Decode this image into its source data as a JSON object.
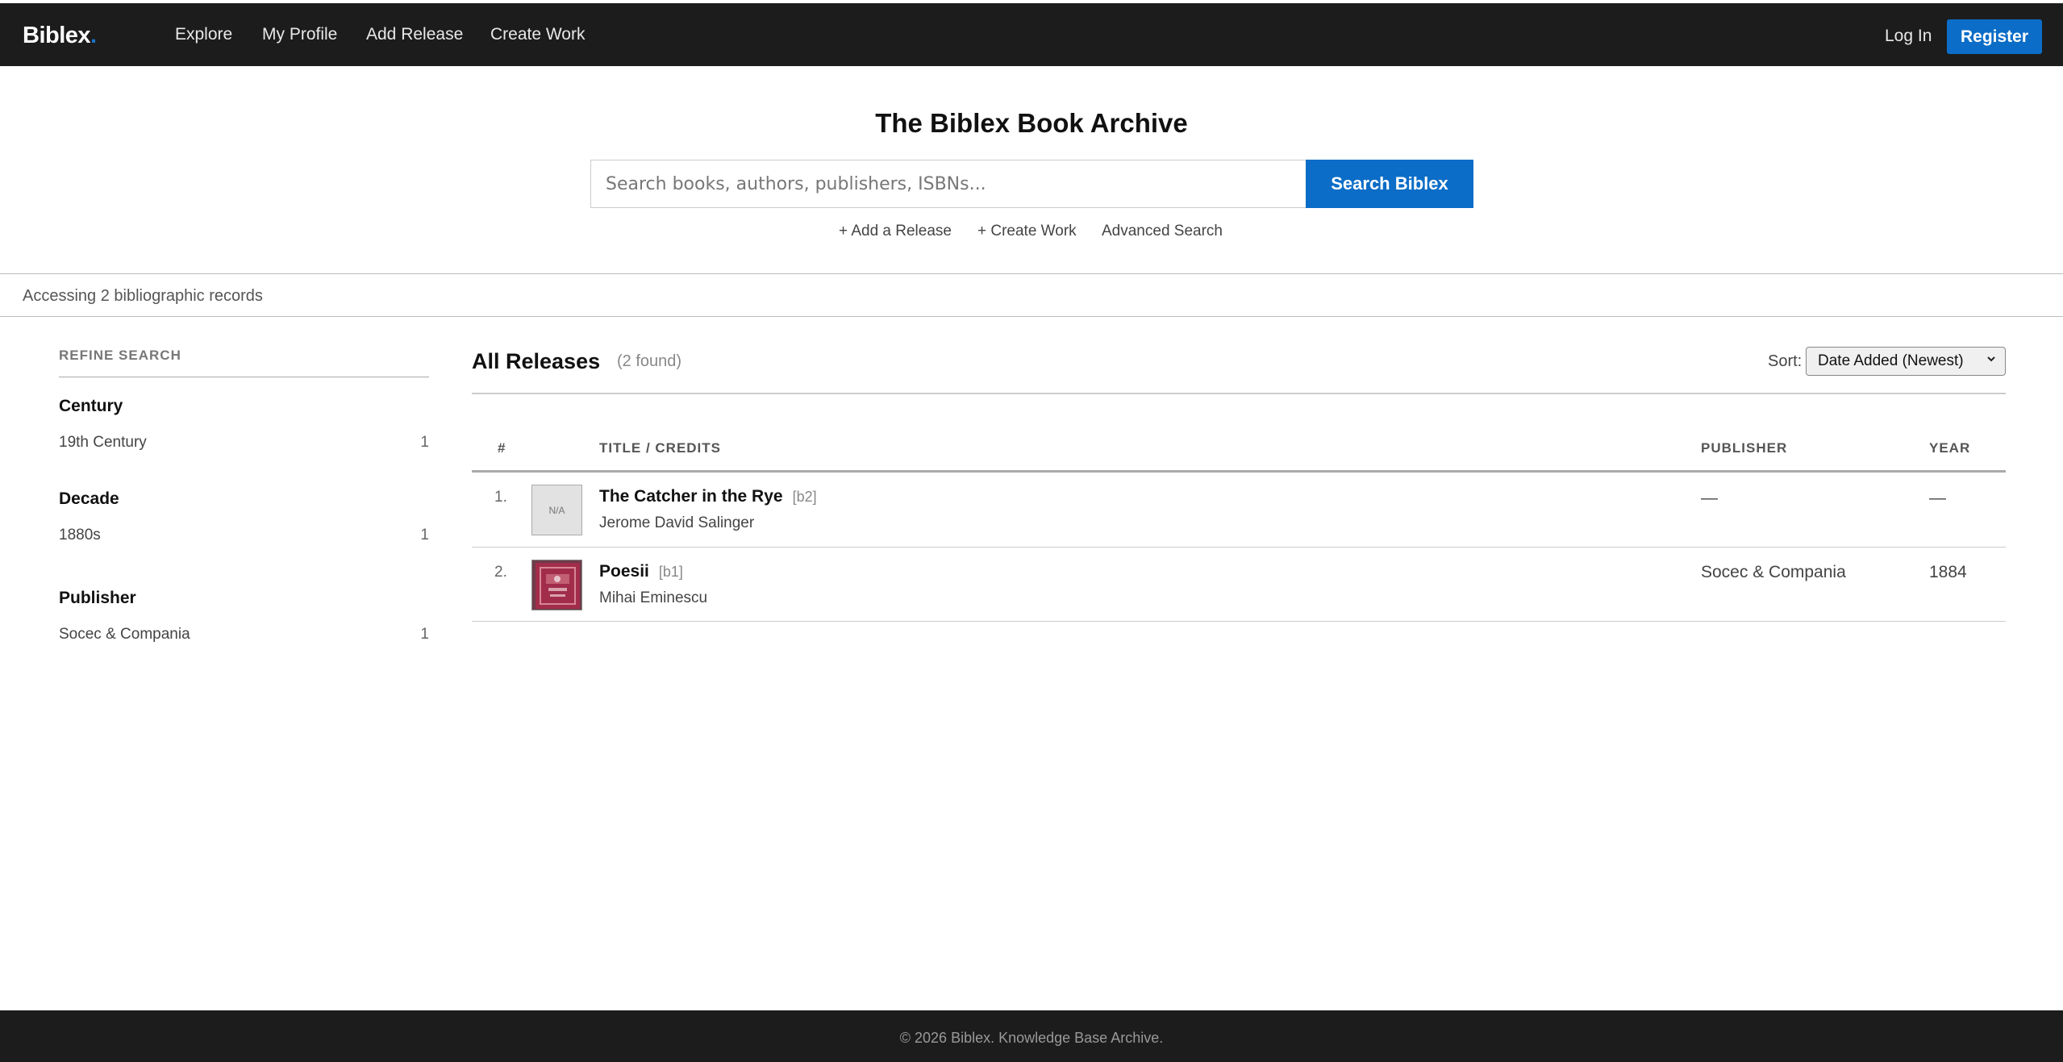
{
  "brand": {
    "name": "Biblex",
    "dot": "."
  },
  "nav": {
    "links": [
      "Explore",
      "My Profile",
      "Add Release",
      "Create Work"
    ],
    "login": "Log In",
    "register": "Register"
  },
  "hero": {
    "title": "The Biblex Book Archive",
    "search_placeholder": "Search books, authors, publishers, ISBNs...",
    "search_button": "Search Biblex",
    "links": [
      "+ Add a Release",
      "+ Create Work",
      "Advanced Search"
    ]
  },
  "status": {
    "text": "Accessing 2 bibliographic records"
  },
  "sidebar": {
    "title": "REFINE SEARCH",
    "facets": [
      {
        "heading": "Century",
        "items": [
          {
            "label": "19th Century",
            "count": "1"
          }
        ]
      },
      {
        "heading": "Decade",
        "items": [
          {
            "label": "1880s",
            "count": "1"
          }
        ]
      },
      {
        "heading": "Publisher",
        "items": [
          {
            "label": "Socec & Compania",
            "count": "1"
          }
        ]
      }
    ]
  },
  "main": {
    "title": "All Releases",
    "found": "(2 found)",
    "sort_label": "Sort:",
    "sort_value": "Date Added (Newest)",
    "columns": [
      "#",
      "TITLE / CREDITS",
      "PUBLISHER",
      "YEAR"
    ],
    "rows": [
      {
        "num": "1.",
        "thumb": "N/A",
        "title": "The Catcher in the Rye",
        "code": "[b2]",
        "author": "Jerome David Salinger",
        "publisher": "—",
        "year": "—"
      },
      {
        "num": "2.",
        "thumb": "",
        "title": "Poesii",
        "code": "[b1]",
        "author": "Mihai Eminescu",
        "publisher": "Socec & Compania",
        "year": "1884"
      }
    ]
  },
  "footer": {
    "text": "© 2026 Biblex. Knowledge Base Archive."
  },
  "colors": {
    "accent": "#0b6dc7",
    "topbar": "#1c1c1c",
    "cover": "#9b2a45"
  }
}
